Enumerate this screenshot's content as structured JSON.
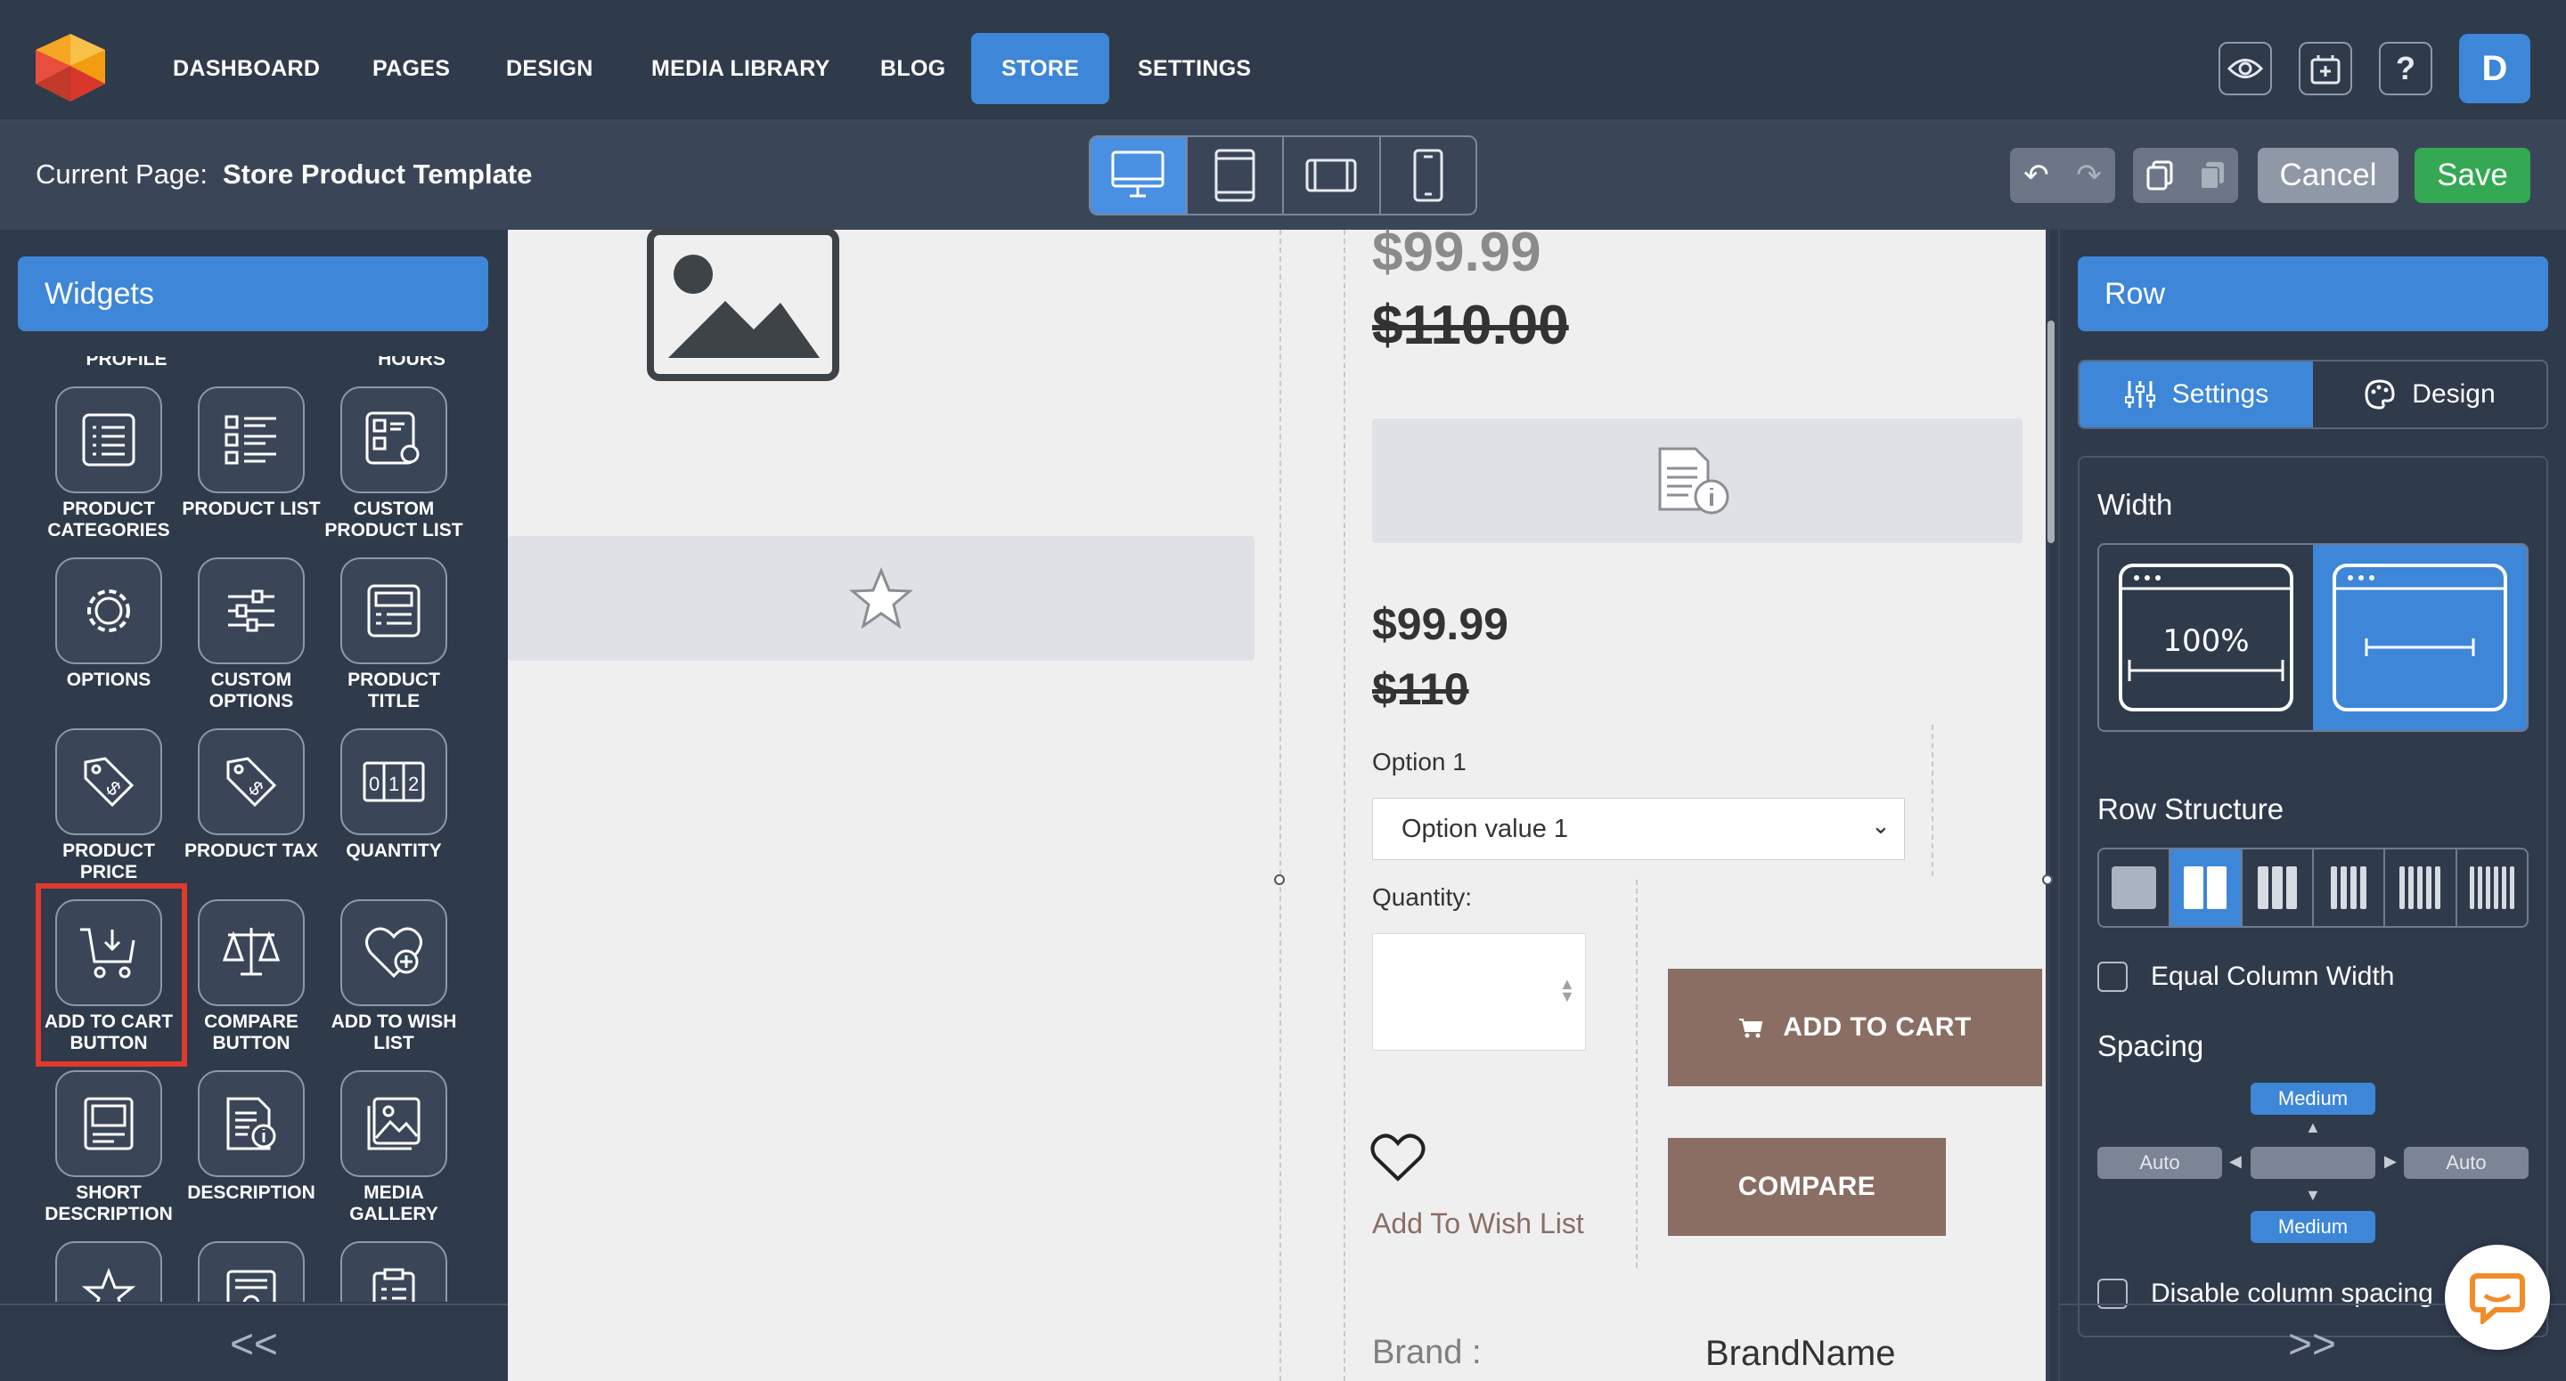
{
  "nav": {
    "items": [
      "DASHBOARD",
      "PAGES",
      "DESIGN",
      "MEDIA LIBRARY",
      "BLOG",
      "STORE",
      "SETTINGS"
    ],
    "active": "STORE",
    "user_initial": "D",
    "icons": [
      "preview-eye-icon",
      "add-page-icon",
      "help-icon"
    ]
  },
  "subbar": {
    "current_page_label": "Current Page:",
    "current_page_value": "Store Product Template",
    "devices": [
      "desktop",
      "tablet-portrait",
      "tablet-landscape",
      "mobile"
    ],
    "active_device": "desktop",
    "cancel_label": "Cancel",
    "save_label": "Save"
  },
  "left_panel": {
    "title": "Widgets",
    "partial_labels": [
      "PROFILE",
      "HOURS"
    ],
    "widgets": [
      {
        "label": "PRODUCT CATEGORIES",
        "icon": "list-icon"
      },
      {
        "label": "PRODUCT LIST",
        "icon": "product-list-icon"
      },
      {
        "label": "CUSTOM PRODUCT LIST",
        "icon": "custom-list-icon"
      },
      {
        "label": "OPTIONS",
        "icon": "gear-icon"
      },
      {
        "label": "CUSTOM OPTIONS",
        "icon": "sliders-icon"
      },
      {
        "label": "PRODUCT TITLE",
        "icon": "title-icon"
      },
      {
        "label": "PRODUCT PRICE",
        "icon": "price-tag-icon"
      },
      {
        "label": "PRODUCT TAX",
        "icon": "tax-tag-icon"
      },
      {
        "label": "QUANTITY",
        "icon": "quantity-icon"
      },
      {
        "label": "ADD TO CART BUTTON",
        "icon": "add-to-cart-icon"
      },
      {
        "label": "COMPARE BUTTON",
        "icon": "scale-icon"
      },
      {
        "label": "ADD TO WISH LIST",
        "icon": "heart-plus-icon"
      },
      {
        "label": "SHORT DESCRIPTION",
        "icon": "short-doc-icon"
      },
      {
        "label": "DESCRIPTION",
        "icon": "doc-info-icon"
      },
      {
        "label": "MEDIA GALLERY",
        "icon": "gallery-icon"
      }
    ],
    "highlighted_widget": "ADD TO CART BUTTON",
    "collapse_label": "<<"
  },
  "canvas": {
    "price_sale_top": "$99.99",
    "price_regular_top": "$110.00",
    "price_sale": "$99.99",
    "price_regular": "$110",
    "option_label": "Option 1",
    "option_value": "Option value 1",
    "quantity_label": "Quantity:",
    "add_to_cart_label": "ADD TO CART",
    "wish_list_label": "Add To Wish List",
    "compare_label": "COMPARE",
    "brand_label": "Brand :",
    "brand_value": "BrandName"
  },
  "right_panel": {
    "title": "Row",
    "tabs": [
      "Settings",
      "Design"
    ],
    "active_tab": "Settings",
    "width_title": "Width",
    "width_full_label": "100%",
    "row_structure_title": "Row Structure",
    "row_structure_options": [
      1,
      2,
      3,
      4,
      5,
      6
    ],
    "active_structure": 2,
    "equal_width_label": "Equal Column Width",
    "spacing_title": "Spacing",
    "spacing_top": "Medium",
    "spacing_bottom": "Medium",
    "spacing_left": "Auto",
    "spacing_right": "Auto",
    "disable_spacing_label": "Disable column spacing",
    "collapse_label": ">>"
  },
  "colors": {
    "nav_bg": "#2f3a4b",
    "accent": "#3d86d8",
    "save": "#34a853",
    "button_brown": "#8a6e63",
    "highlight_red": "#e0392d"
  }
}
